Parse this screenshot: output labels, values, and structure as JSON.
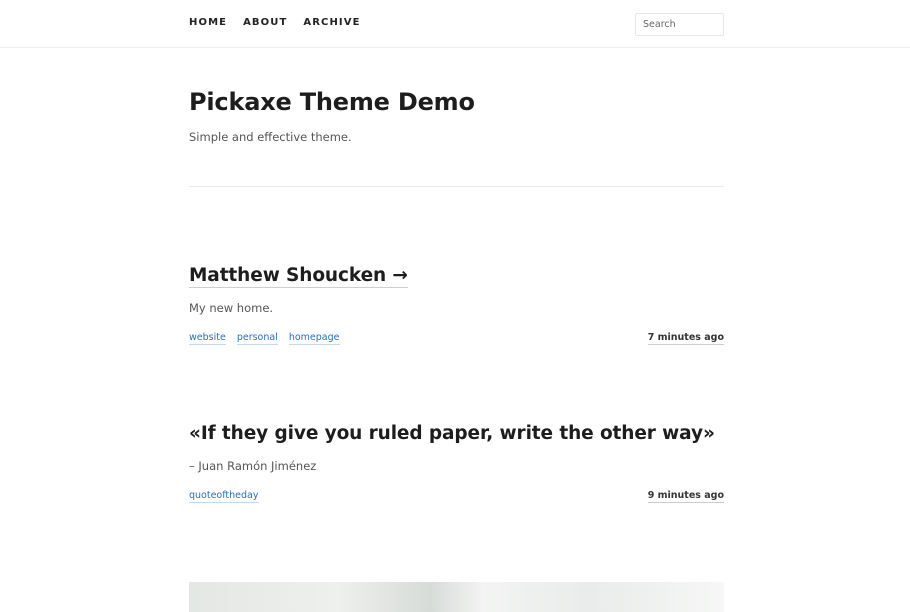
{
  "nav": {
    "items": [
      "HOME",
      "ABOUT",
      "ARCHIVE"
    ],
    "search_placeholder": "Search"
  },
  "site": {
    "title": "Pickaxe Theme Demo",
    "description": "Simple and effective theme."
  },
  "posts": [
    {
      "title": "Matthew Shoucken →",
      "subtitle": "My new home.",
      "tags": [
        "website",
        "personal",
        "homepage"
      ],
      "time": "7 minutes ago"
    },
    {
      "title": "«If they give you ruled paper, write the other way»",
      "subtitle": "– Juan Ramón Jiménez",
      "tags": [
        "quoteoftheday"
      ],
      "time": "9 minutes ago"
    }
  ],
  "colors": {
    "link": "#2a6ebb",
    "text": "#222222",
    "muted": "#555555",
    "rule": "#e9e9e9"
  }
}
